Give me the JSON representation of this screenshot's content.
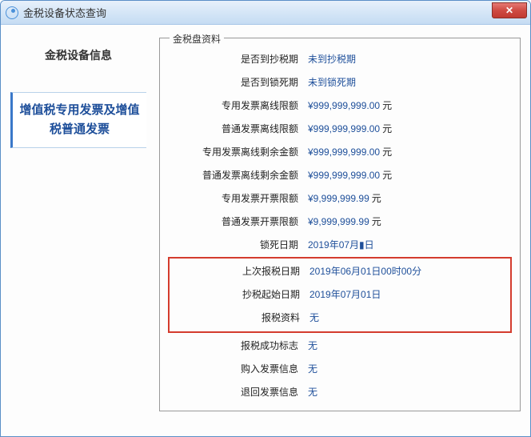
{
  "window": {
    "title": "金税设备状态查询"
  },
  "sidebar": {
    "header": "金税设备信息",
    "tab": "增值税专用发票及增值税普通发票"
  },
  "panel": {
    "legend": "金税盘资料",
    "currency_unit": "元",
    "rows": [
      {
        "label": "是否到抄税期",
        "value": "未到抄税期",
        "unit": false
      },
      {
        "label": "是否到锁死期",
        "value": "未到锁死期",
        "unit": false
      },
      {
        "label": "专用发票离线限额",
        "value": "¥999,999,999.00",
        "unit": true
      },
      {
        "label": "普通发票离线限额",
        "value": "¥999,999,999.00",
        "unit": true
      },
      {
        "label": "专用发票离线剩余金额",
        "value": "¥999,999,999.00",
        "unit": true
      },
      {
        "label": "普通发票离线剩余金额",
        "value": "¥999,999,999.00",
        "unit": true
      },
      {
        "label": "专用发票开票限额",
        "value": "¥9,999,999.99",
        "unit": true
      },
      {
        "label": "普通发票开票限额",
        "value": "¥9,999,999.99",
        "unit": true
      },
      {
        "label": "锁死日期",
        "value": "2019年07月▮日",
        "unit": false
      }
    ],
    "highlight_rows": [
      {
        "label": "上次报税日期",
        "value": "2019年06月01日00时00分",
        "unit": false
      },
      {
        "label": "抄税起始日期",
        "value": "2019年07月01日",
        "unit": false
      },
      {
        "label": "报税资料",
        "value": "无",
        "unit": false
      }
    ],
    "tail_rows": [
      {
        "label": "报税成功标志",
        "value": "无",
        "unit": false
      },
      {
        "label": "购入发票信息",
        "value": "无",
        "unit": false
      },
      {
        "label": "退回发票信息",
        "value": "无",
        "unit": false
      }
    ]
  }
}
